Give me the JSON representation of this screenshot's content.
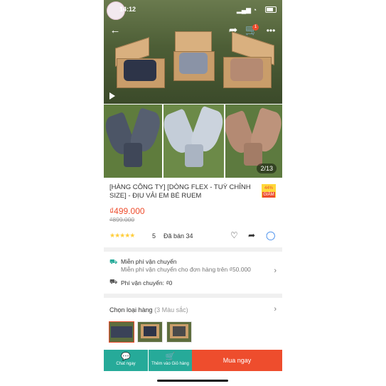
{
  "status_bar": {
    "time": "14:12"
  },
  "hero": {
    "page_indicator": "2/13"
  },
  "nav": {
    "back_icon": "arrow-left-icon",
    "share_icon": "share-icon",
    "cart_icon": "cart-icon",
    "cart_count": "1",
    "more_icon": "more-icon"
  },
  "product": {
    "title": "[HÀNG CÔNG TY] [DÒNG FLEX - TUỲ CHỈNH SIZE] - ĐỊU VẢI EM BÉ RUEM",
    "discount_percent": "44%",
    "discount_label": "GIẢM",
    "price": "₫499.000",
    "old_price": "₫899.000",
    "stars": "★★★★★",
    "rating": "5",
    "sold": "Đã bán 34"
  },
  "shipping": {
    "free_title": "Miễn phí vận chuyển",
    "free_desc": "Miễn phí vận chuyển cho đơn hàng trên ₫50.000",
    "fee_label": "Phí vận chuyển: ₫0"
  },
  "variants": {
    "title": "Chọn loại hàng",
    "count": "(3 Màu sắc)"
  },
  "bottom_bar": {
    "chat_label": "Chat ngay",
    "cart_label": "Thêm vào Giỏ hàng",
    "buy_label": "Mua ngay"
  },
  "colors": {
    "accent": "#ee4d2d",
    "teal": "#26aa99",
    "star": "#ffce3d"
  }
}
